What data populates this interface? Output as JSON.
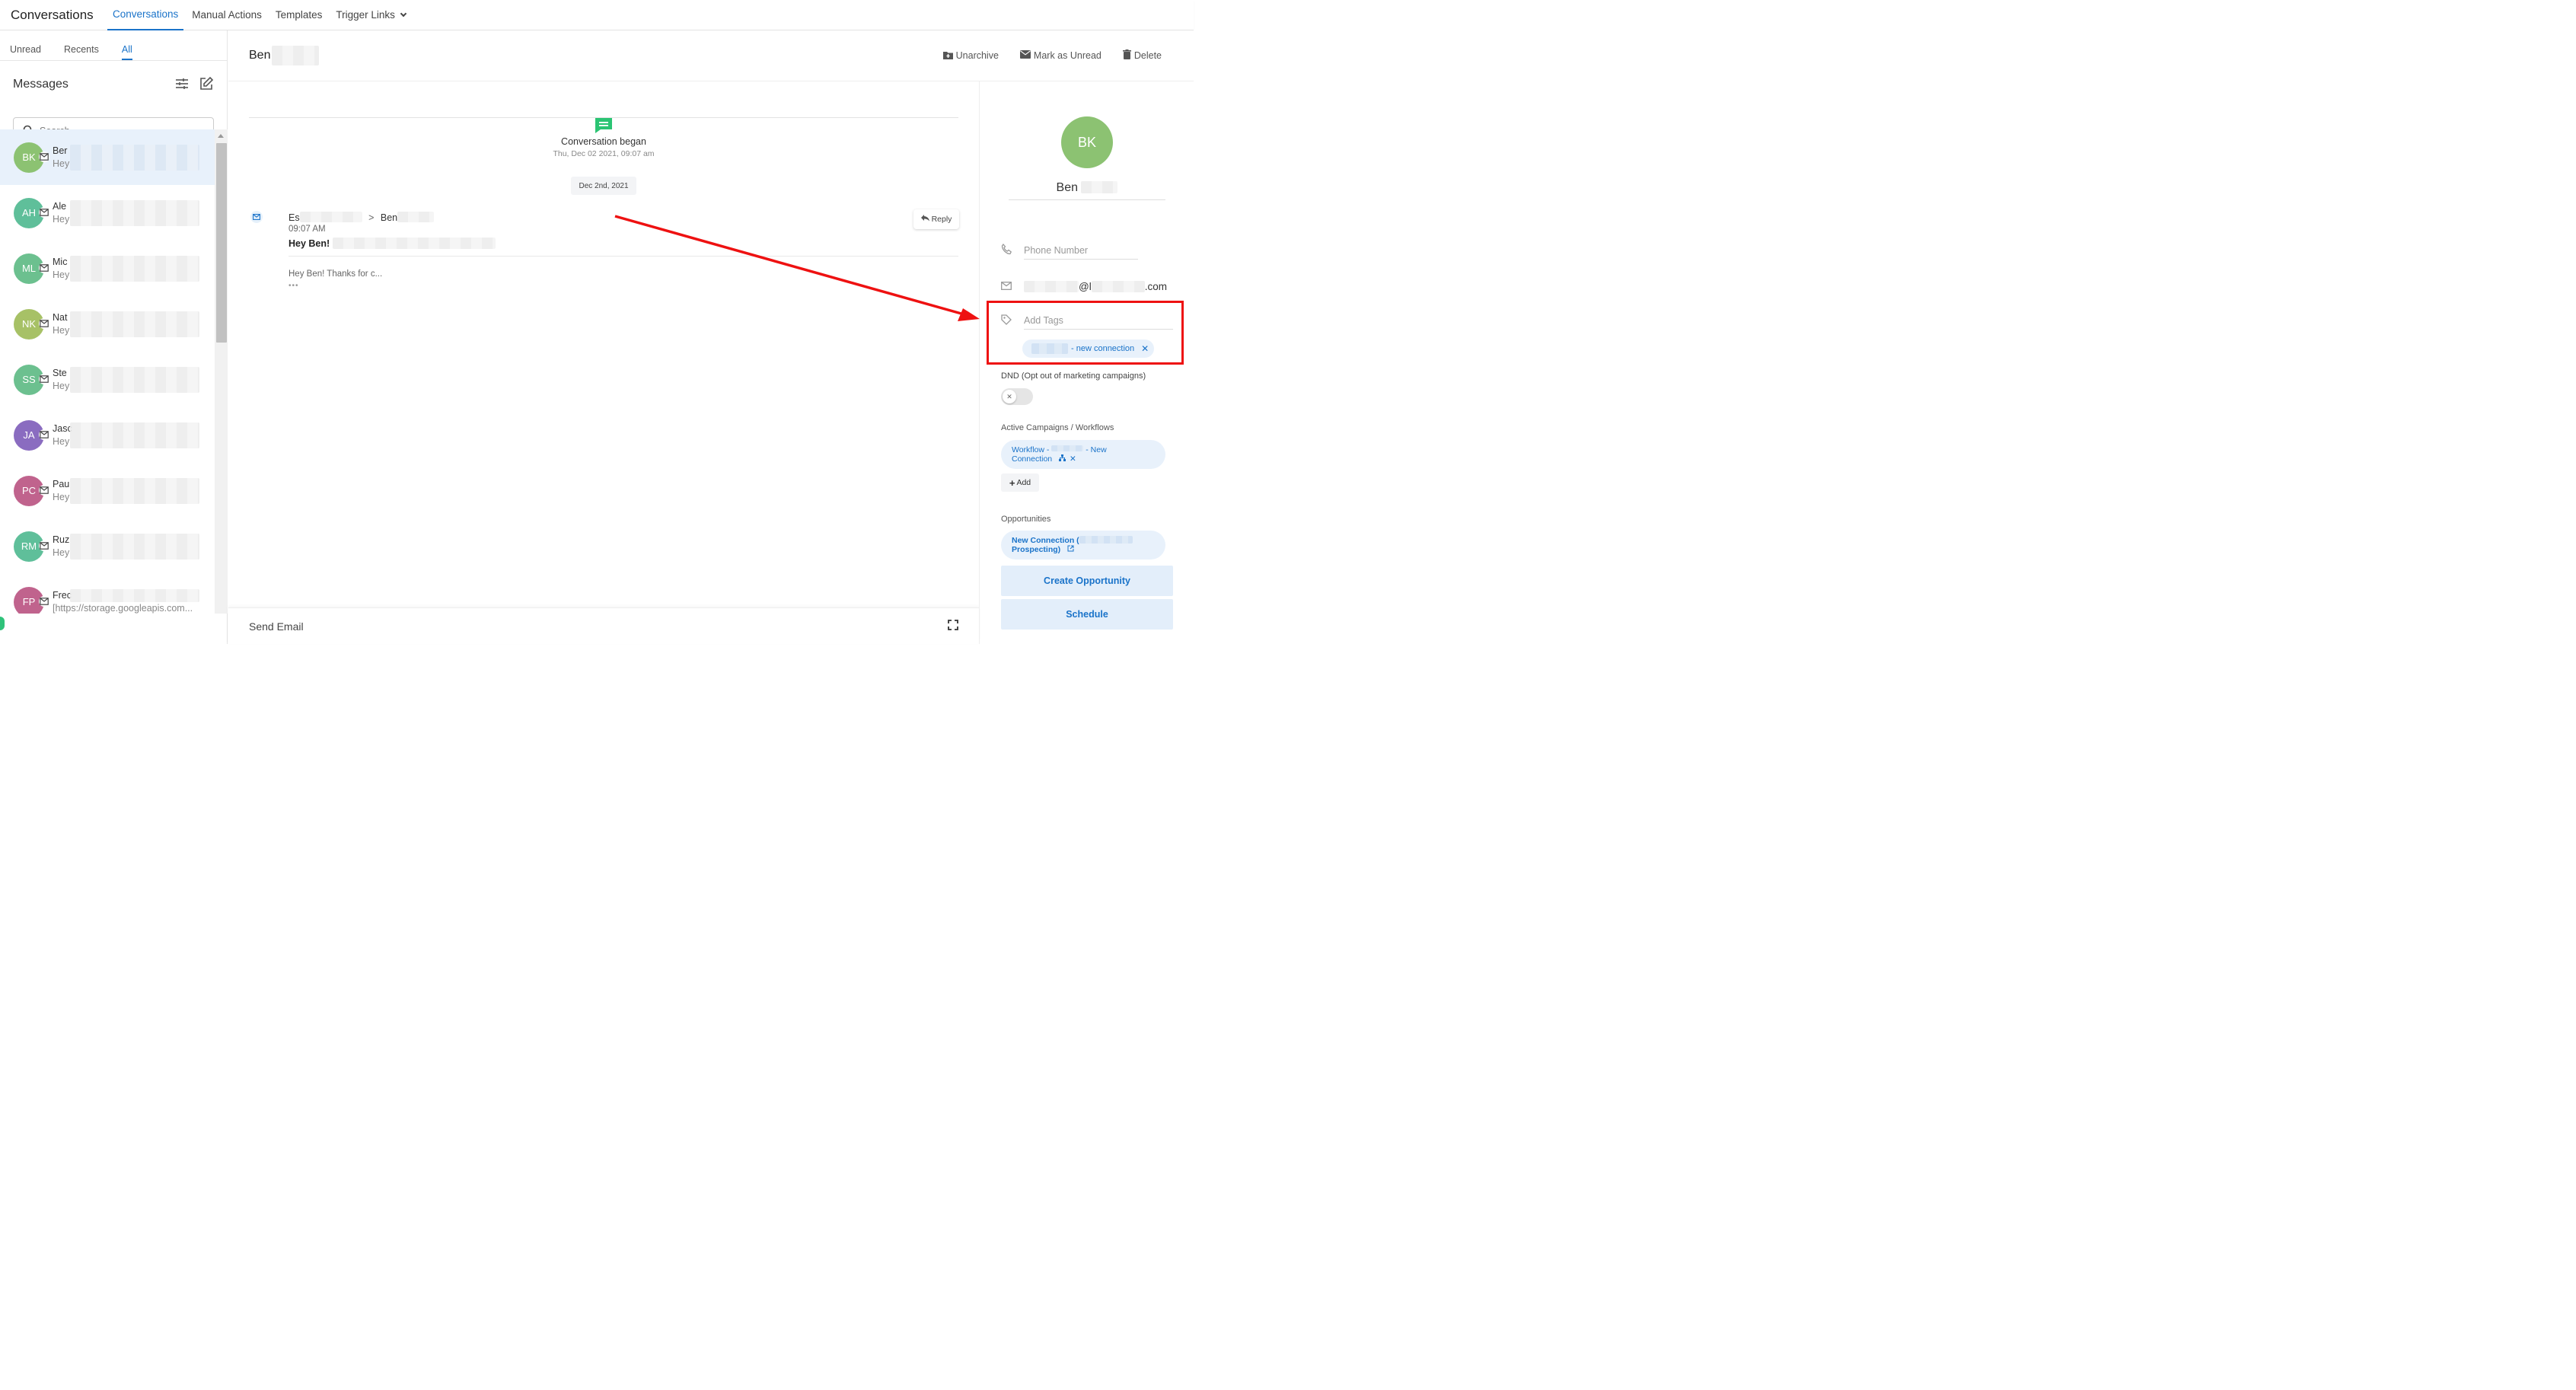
{
  "topnav": {
    "brand": "Conversations",
    "links": [
      "Conversations",
      "Manual Actions",
      "Templates",
      "Trigger Links"
    ]
  },
  "sidebar": {
    "tabs": [
      "Unread",
      "Recents",
      "All"
    ],
    "title": "Messages",
    "search_placeholder": "Search",
    "conversations": [
      {
        "initials": "BK",
        "name": "Ber",
        "preview": "Hey",
        "color": "#8cc272"
      },
      {
        "initials": "AH",
        "name": "Ale",
        "preview": "Hey",
        "color": "#5fbf9a"
      },
      {
        "initials": "ML",
        "name": "Mic",
        "preview": "Hey",
        "color": "#6cc08f"
      },
      {
        "initials": "NK",
        "name": "Nat",
        "preview": "Hey",
        "color": "#a7c166"
      },
      {
        "initials": "SS",
        "name": "Ste",
        "preview": "Hey",
        "color": "#6cc08f"
      },
      {
        "initials": "JA",
        "name": "Jasc",
        "preview": "Hey",
        "color": "#8a6cc0"
      },
      {
        "initials": "PC",
        "name": "Pau",
        "preview": "Hey",
        "color": "#c0638d"
      },
      {
        "initials": "RM",
        "name": "Ruz",
        "preview": "Hey",
        "color": "#5fbf9a"
      },
      {
        "initials": "FP",
        "name": "Frec",
        "preview": "[https://storage.googleapis.com...",
        "color": "#c0638d"
      }
    ]
  },
  "conversation": {
    "contact_name": "Ben",
    "actions": {
      "unarchive": "Unarchive",
      "mark_unread": "Mark as Unread",
      "delete": "Delete"
    },
    "began_title": "Conversation began",
    "began_time": "Thu, Dec 02 2021, 09:07 am",
    "date_pill": "Dec 2nd, 2021",
    "email": {
      "from": "Es",
      "arrow": ">",
      "to": "Ben",
      "time": "09:07 AM",
      "subject": "Hey Ben!",
      "preview": "Hey Ben! Thanks for c...",
      "dots": "•••",
      "reply_label": "Reply"
    },
    "composer_label": "Send Email"
  },
  "contact_panel": {
    "initials": "BK",
    "name": "Ben",
    "phone_placeholder": "Phone Number",
    "email_at": "@l",
    "email_suffix": ".com",
    "tags_placeholder": "Add Tags",
    "tag_text": "- new connection",
    "tag_remove": "✕",
    "dnd_label": "DND (Opt out of marketing campaigns)",
    "dnd_knob": "✕",
    "campaigns_label": "Active Campaigns / Workflows",
    "workflow_line1a": "Workflow -",
    "workflow_line1b": "- New",
    "workflow_line2": "Connection",
    "workflow_remove": "✕",
    "add_label": "Add",
    "opportunities_label": "Opportunities",
    "opportunity_line1": "New Connection (",
    "opportunity_line2": "Prospecting)",
    "create_opportunity": "Create Opportunity",
    "schedule": "Schedule"
  },
  "colors": {
    "accent": "#1a73c9",
    "highlight": "#ee1111",
    "chat_icon": "#2bc473"
  }
}
